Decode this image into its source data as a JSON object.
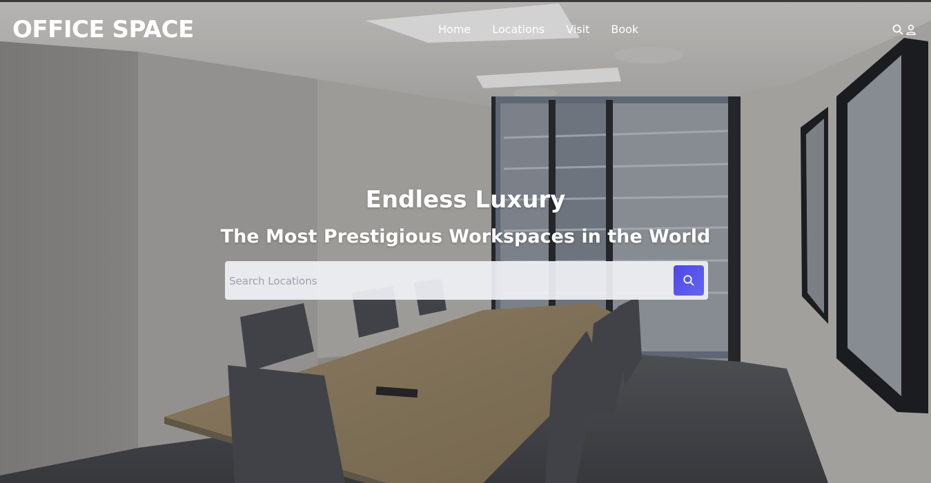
{
  "brand": {
    "name": "OFFICE SPACE"
  },
  "nav": {
    "links": [
      {
        "label": "Home"
      },
      {
        "label": "Locations"
      },
      {
        "label": "Visit"
      },
      {
        "label": "Book"
      }
    ],
    "icons": {
      "search": "search-icon",
      "account": "user-icon"
    }
  },
  "hero": {
    "headline": "Endless Luxury",
    "subheadline": "The Most Prestigious Workspaces in the World",
    "background": "conference-room-photo"
  },
  "search": {
    "placeholder": "Search Locations",
    "value": "",
    "button_icon": "search-icon"
  },
  "colors": {
    "accent": "#5046e5",
    "text_on_hero": "#ffffff",
    "search_field": "#f0f1f5"
  }
}
